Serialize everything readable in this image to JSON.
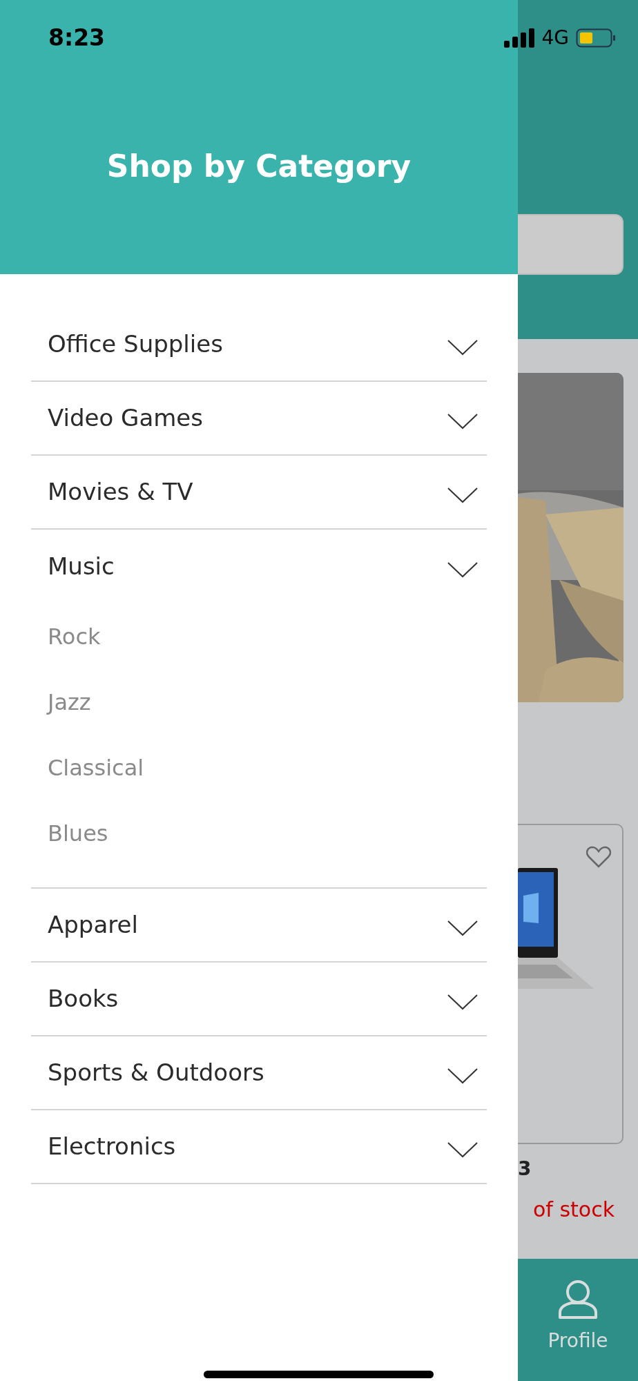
{
  "status_bar": {
    "time": "8:23",
    "network": "4G"
  },
  "drawer": {
    "title": "Shop by Category",
    "categories": [
      {
        "label": "Office Supplies",
        "expanded": false
      },
      {
        "label": "Video Games",
        "expanded": false
      },
      {
        "label": "Movies & TV",
        "expanded": false
      },
      {
        "label": "Music",
        "expanded": true,
        "children": [
          {
            "label": "Rock"
          },
          {
            "label": "Jazz"
          },
          {
            "label": "Classical"
          },
          {
            "label": "Blues"
          }
        ]
      },
      {
        "label": "Apparel",
        "expanded": false
      },
      {
        "label": "Books",
        "expanded": false
      },
      {
        "label": "Sports & Outdoors",
        "expanded": false
      },
      {
        "label": "Electronics",
        "expanded": false
      }
    ]
  },
  "background": {
    "product": {
      "name_fragment": "3",
      "stock": "of stock"
    },
    "bottom_tab": {
      "label": "Profile"
    }
  }
}
